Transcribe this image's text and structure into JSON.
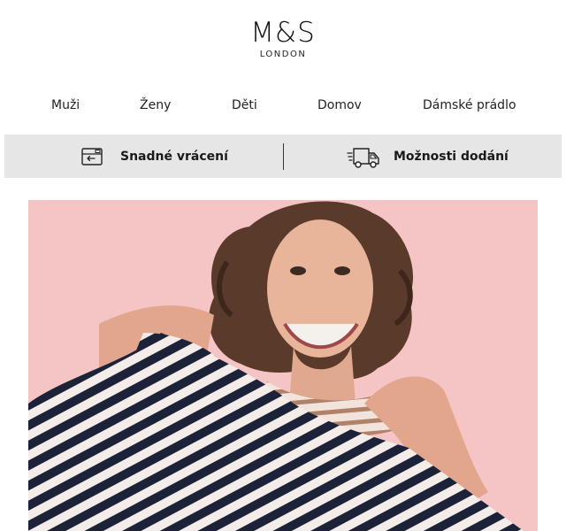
{
  "brand": {
    "name": "M&S",
    "tagline": "LONDON"
  },
  "nav": {
    "items": [
      {
        "label": "Muži"
      },
      {
        "label": "Ženy"
      },
      {
        "label": "Děti"
      },
      {
        "label": "Domov"
      },
      {
        "label": "Dámské prádlo"
      }
    ]
  },
  "services": {
    "returns_label": "Snadné vrácení",
    "delivery_label": "Možnosti dodání",
    "returns_icon": "return-box-icon",
    "delivery_icon": "delivery-truck-icon"
  },
  "hero": {
    "image": "hero-photo",
    "colors": {
      "background": "#f5c5c5",
      "stripe_dark": "#1c2238",
      "stripe_light": "#f4ece8"
    }
  }
}
